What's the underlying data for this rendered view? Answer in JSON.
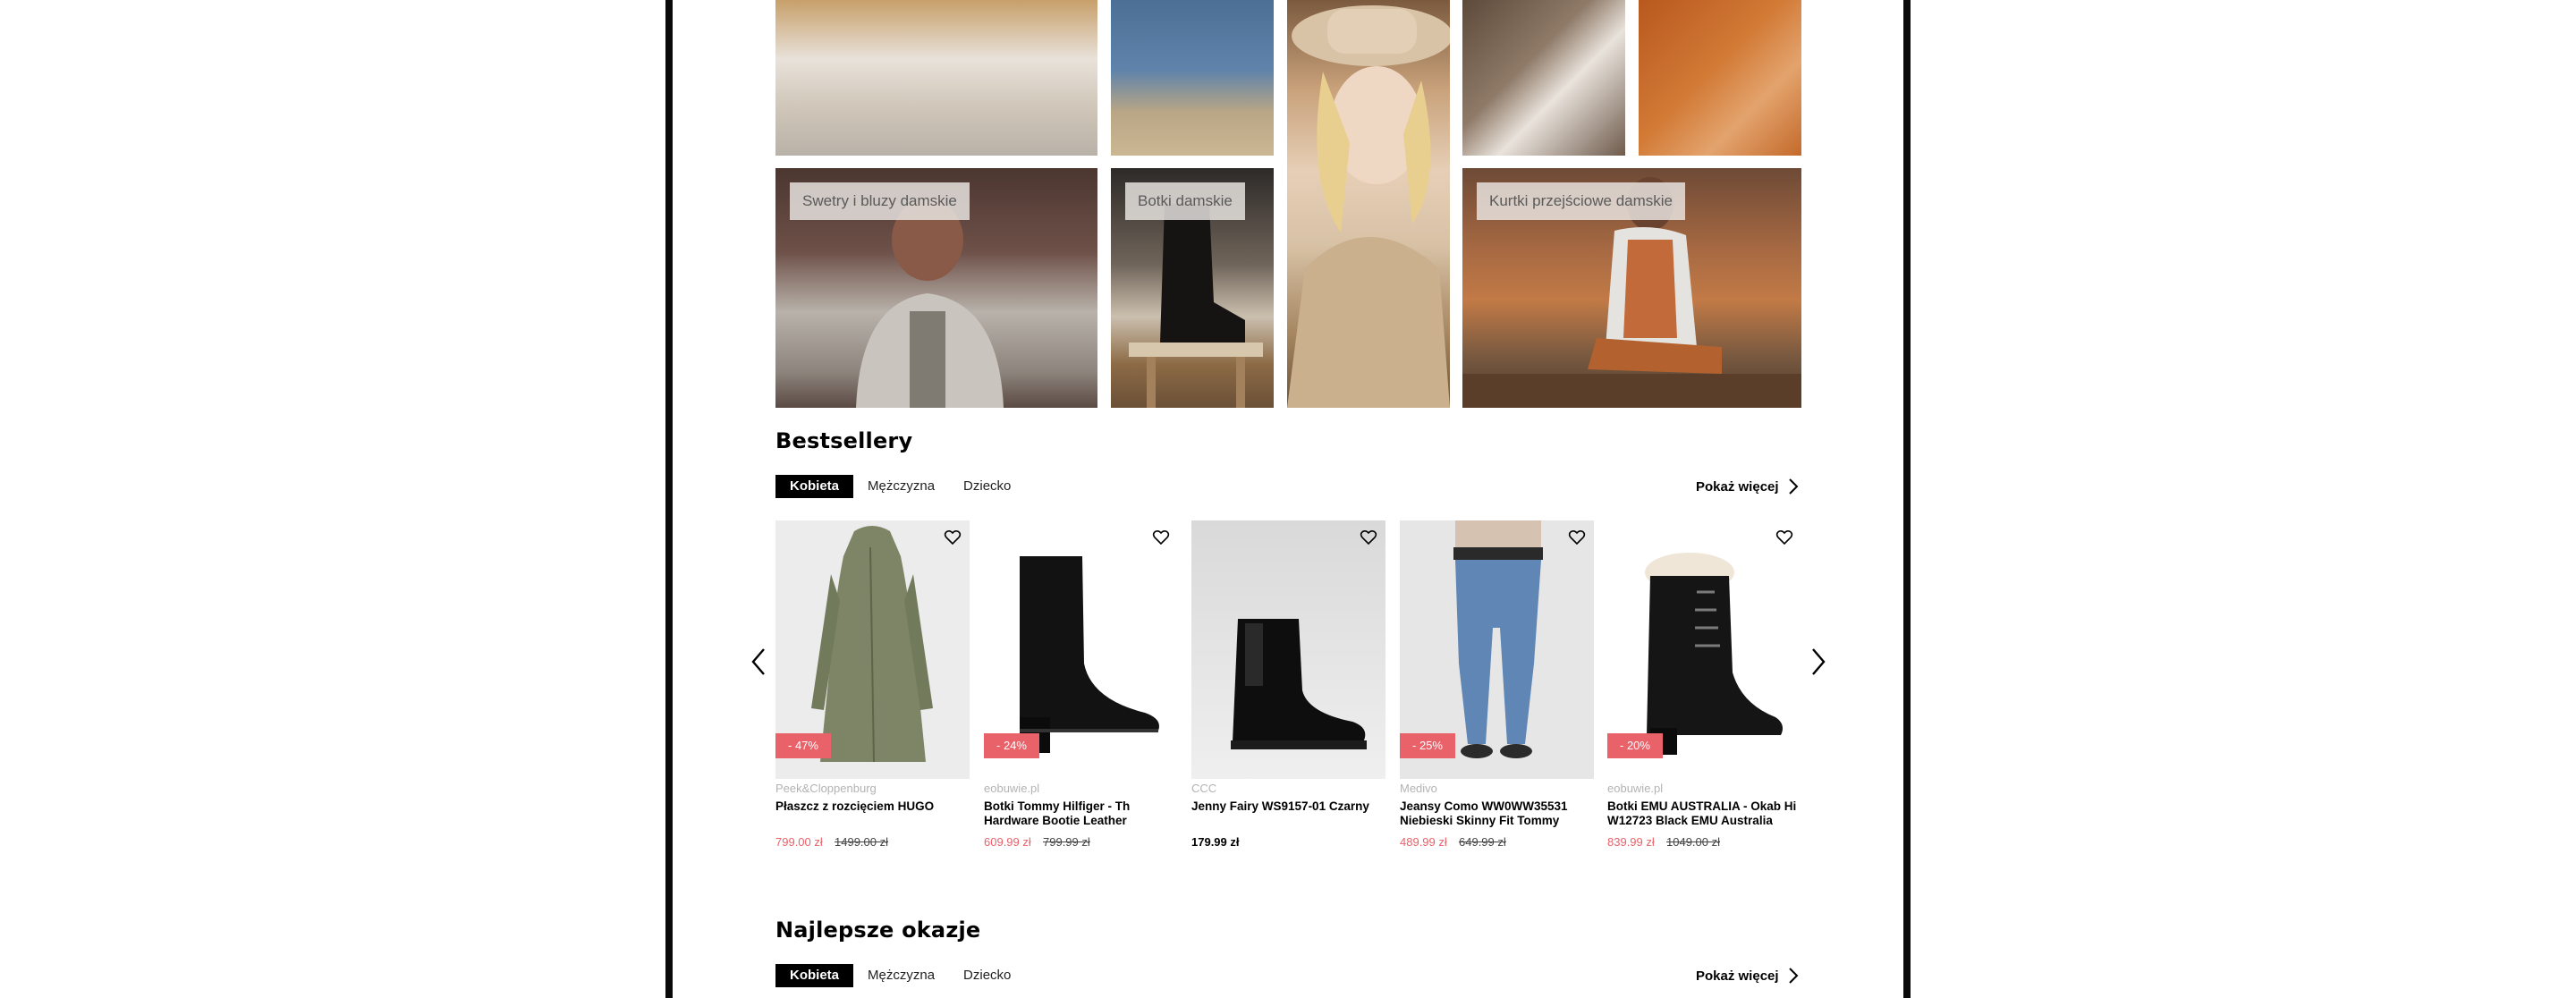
{
  "banners": [
    {
      "tag": ""
    },
    {
      "tag": ""
    },
    {
      "tag": ""
    },
    {
      "tag": ""
    },
    {
      "tag": ""
    },
    {
      "tag": "Swetry i bluzy damskie"
    },
    {
      "tag": "Botki damskie"
    },
    {
      "tag": "Kurtki przejściowe damskie"
    }
  ],
  "bestsellers": {
    "title": "Bestsellery",
    "tabs": [
      "Kobieta",
      "Mężczyzna",
      "Dziecko"
    ],
    "active_tab": "Kobieta",
    "show_more": "Pokaż więcej",
    "products": [
      {
        "shop": "Peek&Cloppenburg",
        "name": "Płaszcz z rozcięciem HUGO",
        "price": "799.00 zł",
        "old_price": "1499.00 zł",
        "discount": "- 47%"
      },
      {
        "shop": "eobuwie.pl",
        "name": "Botki Tommy Hilfiger - Th Hardware Bootie Leather",
        "price": "609.99 zł",
        "old_price": "799.99 zł",
        "discount": "- 24%"
      },
      {
        "shop": "CCC",
        "name": "Jenny Fairy WS9157-01 Czarny",
        "price": "179.99 zł",
        "old_price": "",
        "discount": ""
      },
      {
        "shop": "Medivo",
        "name": "Jeansy Como WW0WW35531 Niebieski Skinny Fit Tommy",
        "price": "489.99 zł",
        "old_price": "649.99 zł",
        "discount": "- 25%"
      },
      {
        "shop": "eobuwie.pl",
        "name": "Botki EMU AUSTRALIA - Okab Hi W12723 Black EMU Australia",
        "price": "839.99 zł",
        "old_price": "1049.00 zł",
        "discount": "- 20%"
      }
    ]
  },
  "deals": {
    "title": "Najlepsze okazje",
    "tabs": [
      "Kobieta",
      "Mężczyzna",
      "Dziecko"
    ],
    "active_tab": "Kobieta",
    "show_more": "Pokaż więcej"
  },
  "colors": {
    "sale": "#e9626a",
    "active_tab_bg": "#000000",
    "frame": "#0a0a0a"
  }
}
